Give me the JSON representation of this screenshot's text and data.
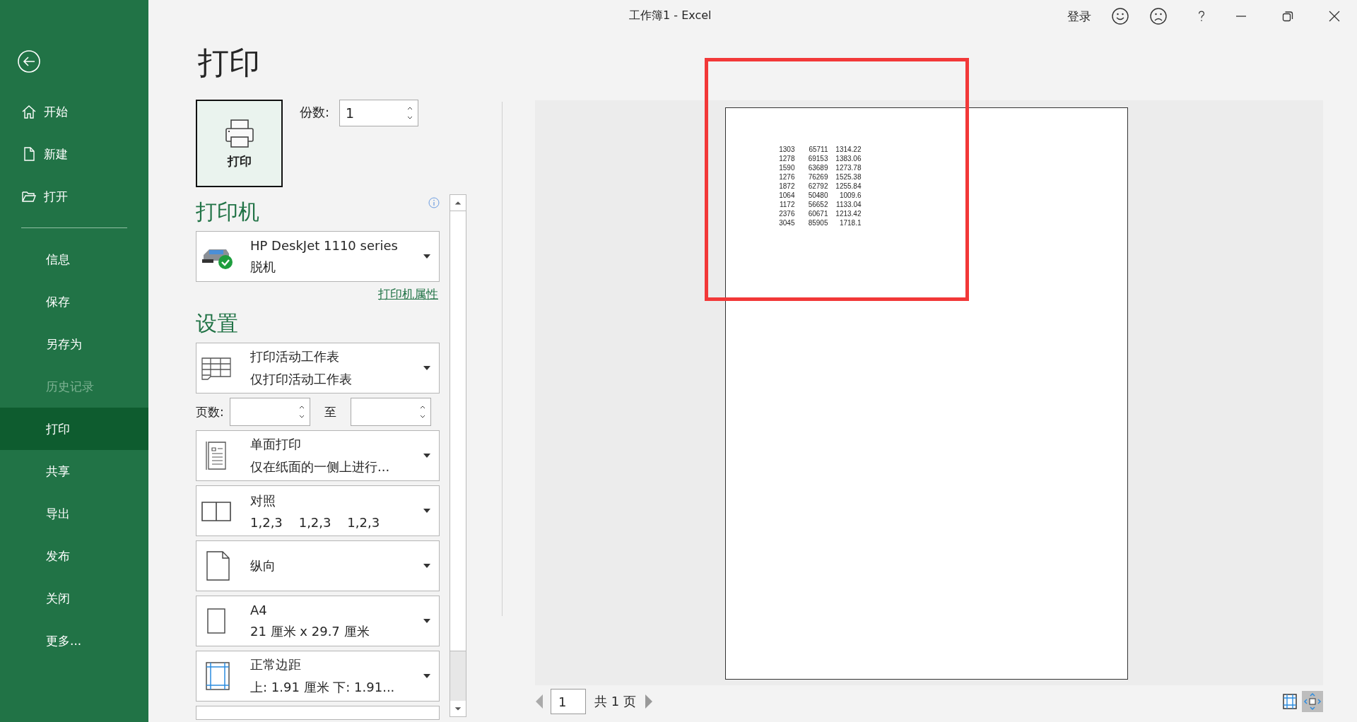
{
  "window": {
    "title": "工作簿1  -  Excel",
    "sign_in": "登录"
  },
  "nav_top": [
    {
      "label": "开始",
      "kind": "home",
      "selected": false,
      "disabled": false
    },
    {
      "label": "新建",
      "kind": "new",
      "selected": false,
      "disabled": false
    },
    {
      "label": "打开",
      "kind": "open",
      "selected": false,
      "disabled": false
    }
  ],
  "nav": [
    {
      "label": "信息",
      "selected": false,
      "disabled": false
    },
    {
      "label": "保存",
      "selected": false,
      "disabled": false
    },
    {
      "label": "另存为",
      "selected": false,
      "disabled": false
    },
    {
      "label": "历史记录",
      "selected": false,
      "disabled": true
    },
    {
      "label": "打印",
      "selected": true,
      "disabled": false
    },
    {
      "label": "共享",
      "selected": false,
      "disabled": false
    },
    {
      "label": "导出",
      "selected": false,
      "disabled": false
    },
    {
      "label": "发布",
      "selected": false,
      "disabled": false
    },
    {
      "label": "关闭",
      "selected": false,
      "disabled": false
    },
    {
      "label": "更多...",
      "selected": false,
      "disabled": false
    }
  ],
  "page_title": "打印",
  "print_button": "打印",
  "copies": {
    "label": "份数:",
    "value": "1"
  },
  "printer": {
    "heading": "打印机",
    "name": "HP DeskJet 1110 series",
    "status": "脱机",
    "properties_link": "打印机属性"
  },
  "settings_heading": "设置",
  "settings": [
    {
      "kind": "sheet",
      "title": "打印活动工作表",
      "detail": "仅打印活动工作表"
    },
    {
      "kind": "pages",
      "label": "页数:",
      "to_label": "至"
    },
    {
      "kind": "sides",
      "title": "单面打印",
      "detail": "仅在纸面的一侧上进行..."
    },
    {
      "kind": "collate",
      "title": "对照",
      "detail": "1,2,3    1,2,3    1,2,3"
    },
    {
      "kind": "portrait",
      "title": "纵向"
    },
    {
      "kind": "paper",
      "title": "A4",
      "detail": "21 厘米 x 29.7 厘米"
    },
    {
      "kind": "margins",
      "title": "正常边距",
      "detail": "上: 1.91 厘米 下: 1.91..."
    },
    {
      "kind": "cut"
    }
  ],
  "preview_rows": [
    [
      "1303",
      "65711",
      "1314.22"
    ],
    [
      "1278",
      "69153",
      "1383.06"
    ],
    [
      "1590",
      "63689",
      "1273.78"
    ],
    [
      "1276",
      "76269",
      "1525.38"
    ],
    [
      "1872",
      "62792",
      "1255.84"
    ],
    [
      "1064",
      "50480",
      "1009.6"
    ],
    [
      "1172",
      "56652",
      "1133.04"
    ],
    [
      "2376",
      "60671",
      "1213.42"
    ],
    [
      "3045",
      "85905",
      "1718.1"
    ]
  ],
  "pager": {
    "value": "1",
    "total": "共 1 页"
  }
}
